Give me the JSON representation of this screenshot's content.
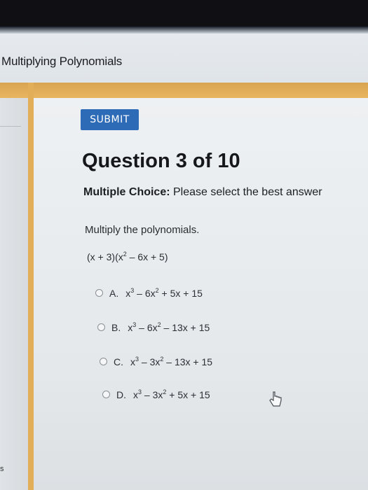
{
  "app": {
    "title": "Multiplying Polynomials"
  },
  "toolbar": {
    "submit_label": "SUBMIT"
  },
  "question": {
    "title": "Question 3 of 10",
    "type_label": "Multiple Choice:",
    "instruction": " Please select the best answer",
    "prompt": "Multiply the polynomials.",
    "expression": {
      "p1": "(x + 3)(x",
      "e1": "2",
      "p2": " – 6x + 5)"
    }
  },
  "choices": [
    {
      "letter": "A.",
      "parts": [
        "x",
        "3",
        " – 6x",
        "2",
        " + 5x + 15"
      ]
    },
    {
      "letter": "B.",
      "parts": [
        "x",
        "3",
        " – 6x",
        "2",
        " – 13x + 15"
      ]
    },
    {
      "letter": "C.",
      "parts": [
        "x",
        "3",
        " – 3x",
        "2",
        " – 13x + 15"
      ]
    },
    {
      "letter": "D.",
      "parts": [
        "x",
        "3",
        " – 3x",
        "2",
        " + 5x + 15"
      ]
    }
  ],
  "misc": {
    "left_edge_char": "s"
  }
}
